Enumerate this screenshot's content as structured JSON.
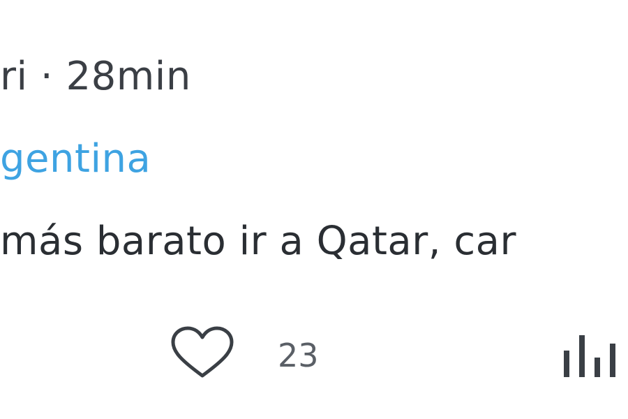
{
  "post": {
    "author_partial": "ri",
    "separator": " · ",
    "time": "28min",
    "reply_to_partial": "gentina",
    "text_partial": " más barato ir a Qatar, car"
  },
  "actions": {
    "like_icon": "heart-icon",
    "like_count": "23",
    "stats_icon": "bar-chart-icon"
  },
  "colors": {
    "link": "#3ea3e2",
    "text": "#2a2e33",
    "muted": "#5a5f66"
  }
}
